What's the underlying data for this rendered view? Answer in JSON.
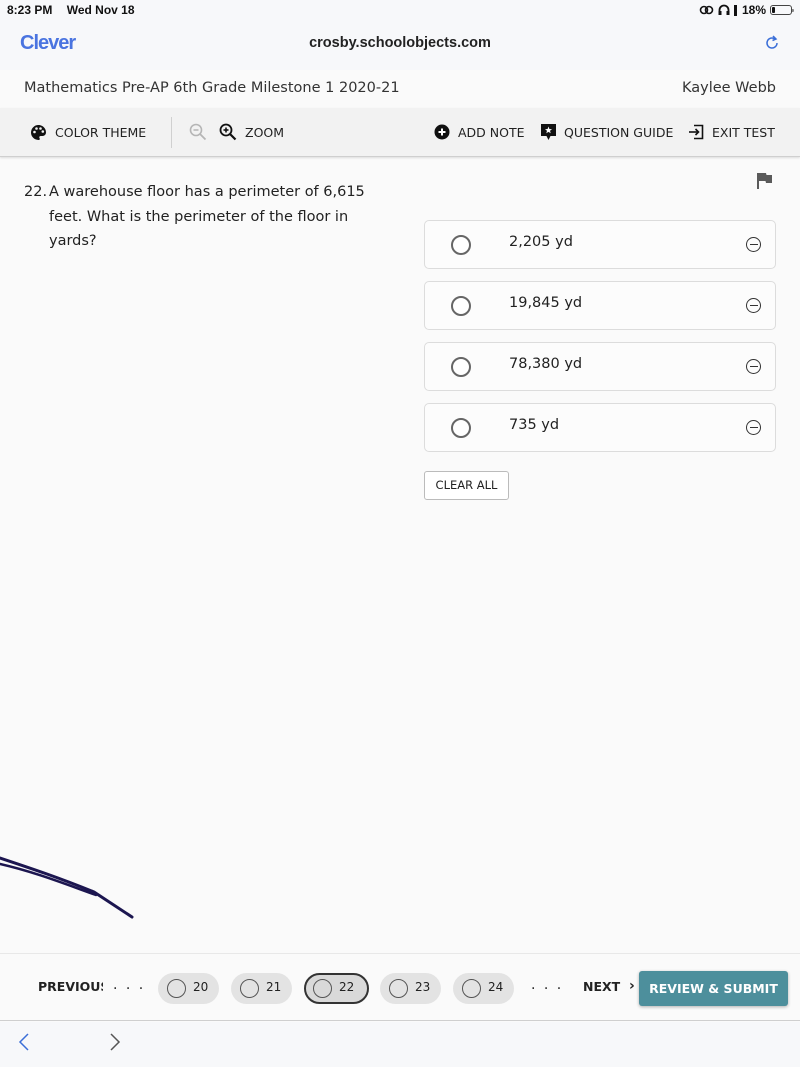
{
  "status_bar": {
    "time": "8:23 PM",
    "date": "Wed Nov 18",
    "battery_percent": "18%",
    "battery_level": 0.18,
    "icons": [
      "link-icon",
      "headphones-icon",
      "signal-icon",
      "battery-icon"
    ]
  },
  "browser": {
    "site_name": "Clever",
    "url": "crosby.schoolobjects.com",
    "reload_icon": "reload-icon",
    "back_icon": "chevron-left-icon",
    "forward_icon": "chevron-right-icon",
    "accent_color": "#4a74e0"
  },
  "header": {
    "test_title": "Mathematics Pre-AP 6th Grade Milestone 1 2020-21",
    "user_name": "Kaylee Webb"
  },
  "toolbar": {
    "color_theme": "COLOR THEME",
    "zoom": "ZOOM",
    "add_note": "ADD NOTE",
    "question_guide": "QUESTION GUIDE",
    "exit_test": "EXIT TEST"
  },
  "question": {
    "number": "22.",
    "text": "A warehouse floor has a perimeter of 6,615 feet. What is the perimeter of the floor in yards?",
    "flagged": false,
    "choices": [
      {
        "label": "2,205 yd",
        "selected": false
      },
      {
        "label": "19,845 yd",
        "selected": false
      },
      {
        "label": "78,380 yd",
        "selected": false
      },
      {
        "label": "735 yd",
        "selected": false
      }
    ],
    "clear_all": "CLEAR ALL"
  },
  "footer": {
    "previous": "PREVIOUS",
    "ellipsis": ". . .",
    "questions": [
      {
        "number": "20",
        "current": false
      },
      {
        "number": "21",
        "current": false
      },
      {
        "number": "22",
        "current": true
      },
      {
        "number": "23",
        "current": false
      },
      {
        "number": "24",
        "current": false
      }
    ],
    "next": "NEXT",
    "next_chevron": "›",
    "review_submit": "REVIEW & SUBMIT",
    "submit_color": "#4d8f9c"
  }
}
